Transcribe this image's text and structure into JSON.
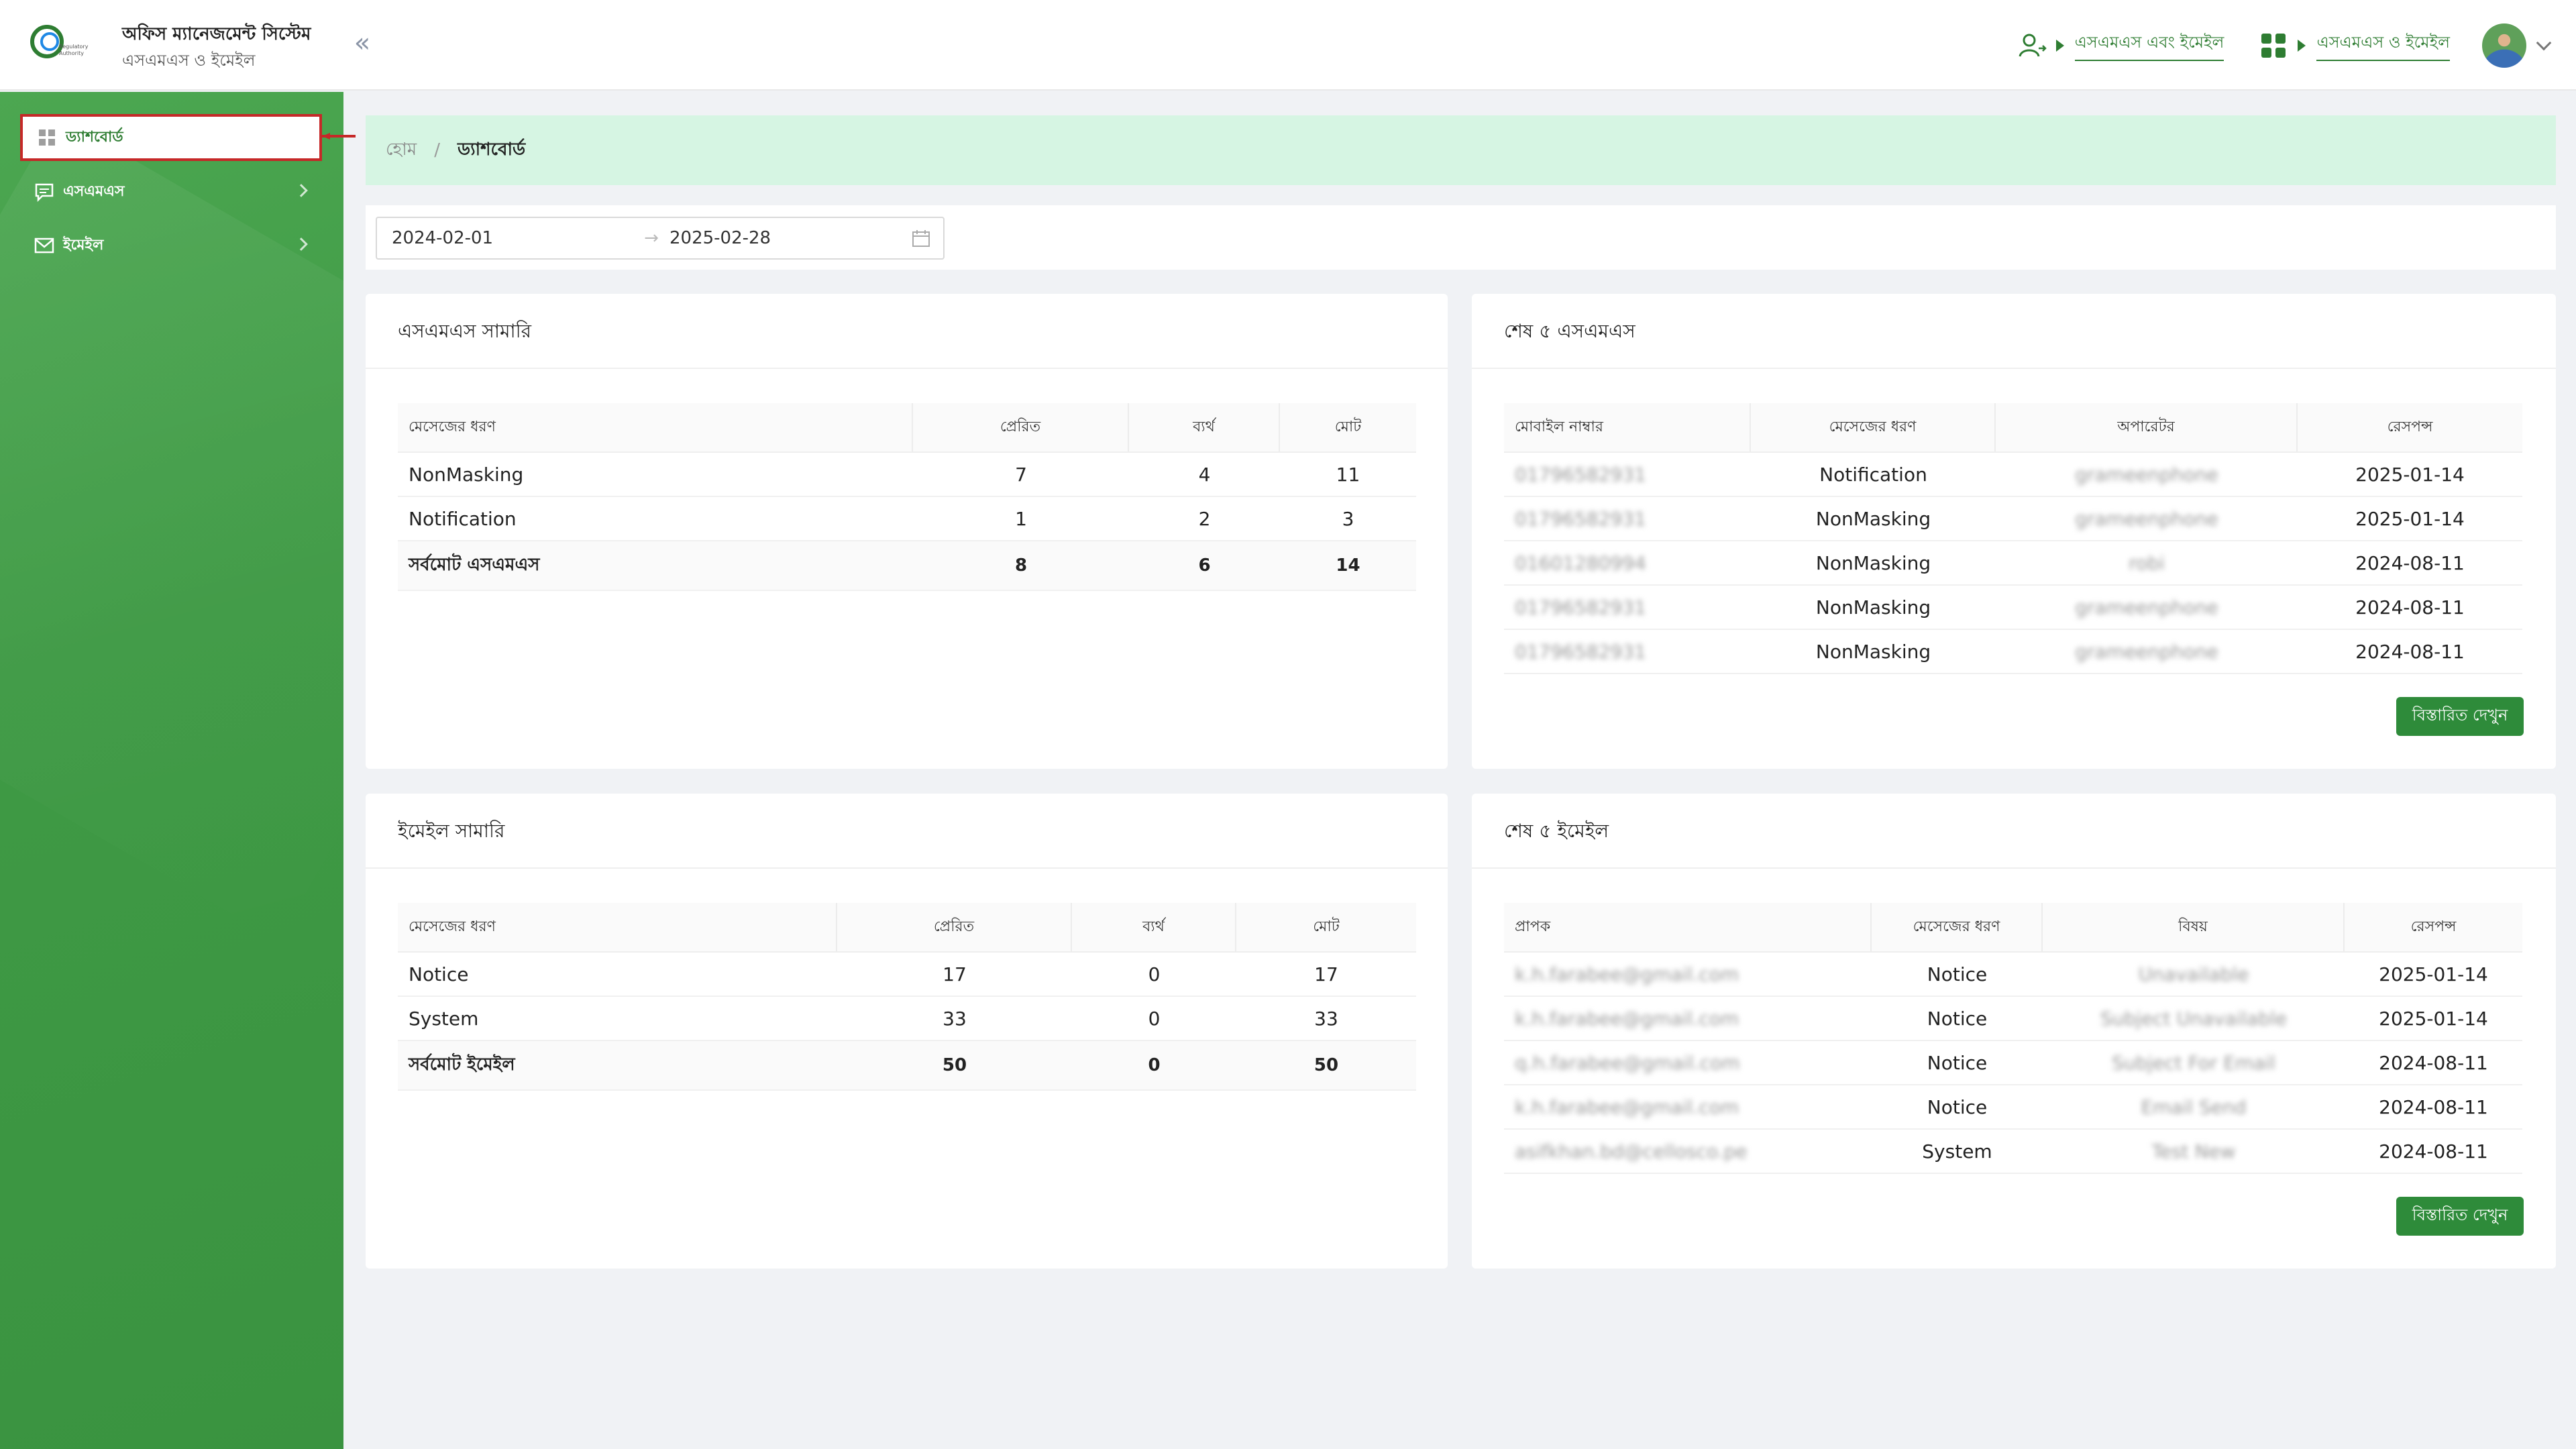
{
  "header": {
    "app_title": "অফিস ম্যানেজমেন্ট সিস্টেম",
    "app_subtitle": "এসএমএস ও ইমেইল",
    "logo_text": "Bangladesh Regulatory Authority",
    "link_sms_email": "এসএমএস এবং ইমেইল",
    "link_sms_email_2": "এসএমএস ও ইমেইল",
    "icons": [
      "user-switch-icon",
      "apps-grid-icon",
      "avatar",
      "chevron-down-icon"
    ]
  },
  "sidebar": {
    "items": [
      {
        "label": "ড্যাশবোর্ড",
        "icon": "dashboard-icon",
        "active": true
      },
      {
        "label": "এসএমএস",
        "icon": "message-icon"
      },
      {
        "label": "ইমেইল",
        "icon": "mail-icon"
      }
    ]
  },
  "breadcrumb": {
    "home": "হোম",
    "separator": "/",
    "current": "ড্যাশবোর্ড"
  },
  "filter": {
    "start": "2024-02-01",
    "end": "2025-02-28"
  },
  "sms_summary": {
    "title": "এসএমএস সামারি",
    "headers": [
      "মেসেজের ধরণ",
      "প্রেরিত",
      "ব্যর্থ",
      "মোট"
    ],
    "rows": [
      [
        "NonMasking",
        "7",
        "4",
        "11"
      ],
      [
        "Notification",
        "1",
        "2",
        "3"
      ]
    ],
    "total": [
      "সর্বমোট এসএমএস",
      "8",
      "6",
      "14"
    ]
  },
  "last_sms": {
    "title": "শেষ ৫ এসএমএস",
    "headers": [
      "মোবাইল নাম্বার",
      "মেসেজের ধরণ",
      "অপারেটর",
      "রেসপন্স"
    ],
    "rows": [
      [
        "01796582931",
        "Notification",
        "grameenphone",
        "2025-01-14"
      ],
      [
        "01796582931",
        "NonMasking",
        "grameenphone",
        "2025-01-14"
      ],
      [
        "01601280994",
        "NonMasking",
        "robi",
        "2024-08-11"
      ],
      [
        "01796582931",
        "NonMasking",
        "grameenphone",
        "2024-08-11"
      ],
      [
        "01796582931",
        "NonMasking",
        "grameenphone",
        "2024-08-11"
      ]
    ],
    "button": "বিস্তারিত দেখুন"
  },
  "email_summary": {
    "title": "ইমেইল সামারি",
    "headers": [
      "মেসেজের ধরণ",
      "প্রেরিত",
      "ব্যর্থ",
      "মোট"
    ],
    "rows": [
      [
        "Notice",
        "17",
        "0",
        "17"
      ],
      [
        "System",
        "33",
        "0",
        "33"
      ]
    ],
    "total": [
      "সর্বমোট ইমেইল",
      "50",
      "0",
      "50"
    ]
  },
  "last_email": {
    "title": "শেষ ৫ ইমেইল",
    "headers": [
      "প্রাপক",
      "মেসেজের ধরণ",
      "বিষয়",
      "রেসপন্স"
    ],
    "rows": [
      [
        "k.h.farabee@gmail.com",
        "Notice",
        "Unavailable",
        "2025-01-14"
      ],
      [
        "k.h.farabee@gmail.com",
        "Notice",
        "Subject Unavailable",
        "2025-01-14"
      ],
      [
        "q.h.farabee@gmail.com",
        "Notice",
        "Subject For Email",
        "2024-08-11"
      ],
      [
        "k.h.farabee@gmail.com",
        "Notice",
        "Email Send",
        "2024-08-11"
      ],
      [
        "asifkhan.bd@cellosco.pe",
        "System",
        "Test New",
        "2024-08-11"
      ]
    ],
    "button": "বিস্তারিত দেখুন"
  },
  "colors": {
    "brand_green": "#2e8b3a",
    "breadcrumb_bg": "#d6f5e3",
    "active_outline": "#c62828"
  }
}
